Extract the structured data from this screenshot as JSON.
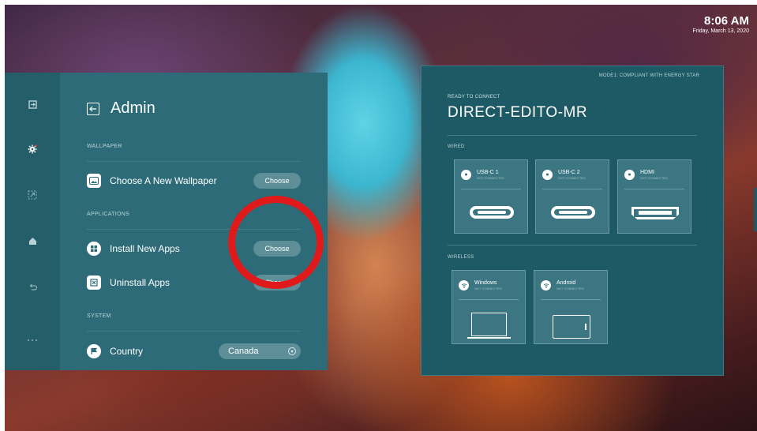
{
  "clock": {
    "time": "8:06 AM",
    "date": "Friday, March 13, 2020"
  },
  "rail": {
    "icons": [
      "input-icon",
      "gear-icon",
      "screen-share-icon",
      "home-icon",
      "back-arrow-icon",
      "more-icon"
    ]
  },
  "admin": {
    "title": "Admin",
    "wallpaper_section": "WALLPAPER",
    "choose_wallpaper_label": "Choose A New Wallpaper",
    "choose_wallpaper_button": "Choose",
    "applications_section": "APPLICATIONS",
    "install_apps_label": "Install New Apps",
    "install_apps_button": "Choose",
    "uninstall_apps_label": "Uninstall Apps",
    "uninstall_apps_button": "Choose",
    "system_section": "SYSTEM",
    "country_label": "Country",
    "country_value": "Canada"
  },
  "connect": {
    "mode": "MODE1: COMPLIANT WITH ENERGY STAR",
    "ready": "READY TO CONNECT",
    "device_name": "DIRECT-EDITO-MR",
    "wired_section": "WIRED",
    "wired_ports": [
      {
        "name": "USB-C 1",
        "status": "NOT CONNECTED"
      },
      {
        "name": "USB-C 2",
        "status": "NOT CONNECTED"
      },
      {
        "name": "HDMI",
        "status": "NOT CONNECTED"
      }
    ],
    "wireless_section": "WIRELESS",
    "wireless_ports": [
      {
        "name": "Windows",
        "status": "NOT CONNECTED"
      },
      {
        "name": "Android",
        "status": "NOT CONNECTED"
      }
    ]
  },
  "colors": {
    "panel": "#2c6b77",
    "rail": "#245e69",
    "connect_panel": "#1d5a65",
    "highlight_circle": "#e01a1a"
  }
}
